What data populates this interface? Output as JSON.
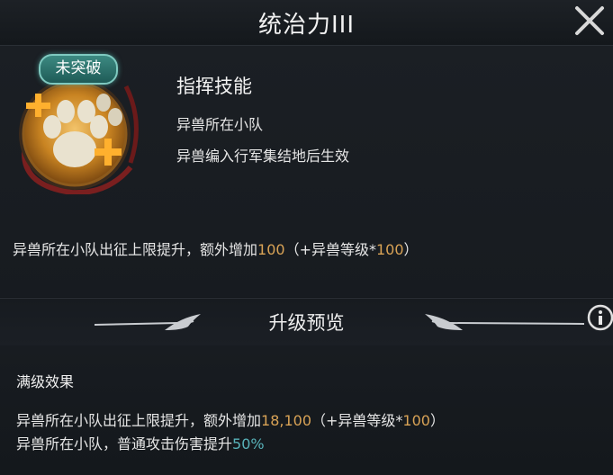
{
  "header": {
    "title": "统治力III"
  },
  "skill": {
    "badge": "未突破",
    "type": "指挥技能",
    "conditions": [
      "异兽所在小队",
      "异兽编入行军集结地后生效"
    ],
    "description": {
      "prefix": "异兽所在小队出征上限提升，额外增加",
      "value": "100",
      "formula_prefix": "（+异兽等级*",
      "formula_value": "100",
      "formula_suffix": "）"
    }
  },
  "preview": {
    "title": "升级预览",
    "max_label": "满级效果",
    "effect1": {
      "prefix": "异兽所在小队出征上限提升，额外增加",
      "value": "18,100",
      "formula_prefix": "（+异兽等级*",
      "formula_value": "100",
      "formula_suffix": "）"
    },
    "effect2": {
      "prefix": "异兽所在小队，普通攻击伤害提升",
      "value": "50%"
    }
  },
  "icons": {
    "close": "close-icon",
    "info": "info-icon",
    "emblem": "paw-emblem-icon"
  },
  "colors": {
    "highlight_gold": "#d9a356",
    "highlight_teal": "#58b2b9",
    "background": "#12161a"
  }
}
